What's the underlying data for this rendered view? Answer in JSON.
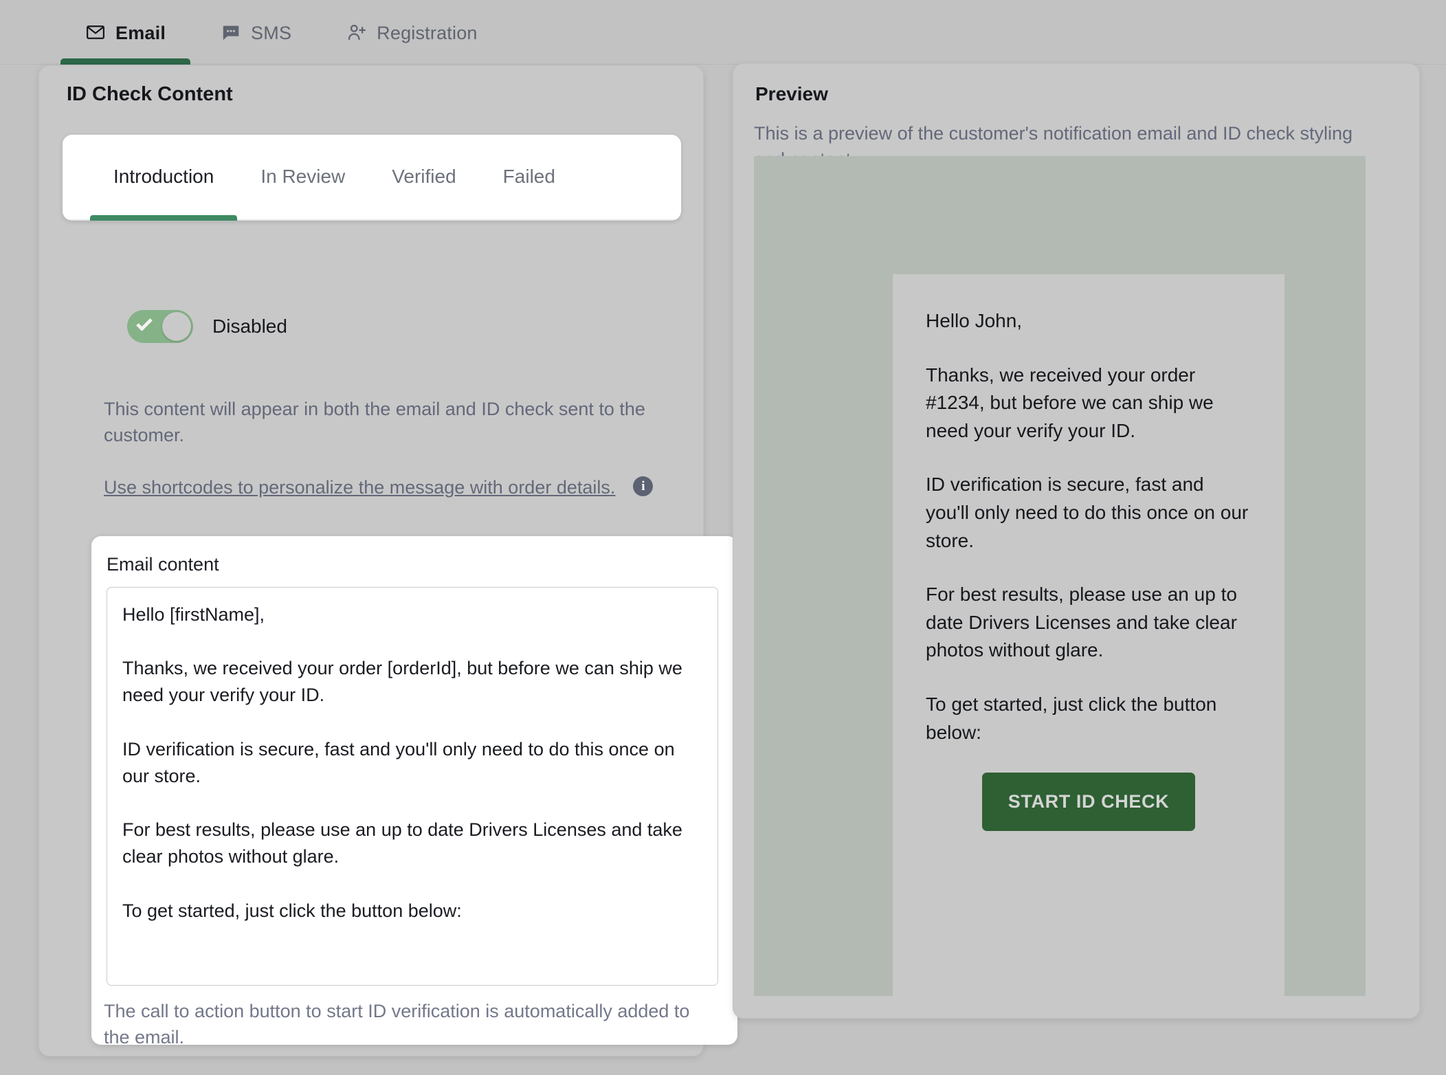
{
  "top_tabs": [
    {
      "label": "Email",
      "icon": "envelope-icon",
      "active": true
    },
    {
      "label": "SMS",
      "icon": "chat-bubble-icon",
      "active": false
    },
    {
      "label": "Registration",
      "icon": "person-add-icon",
      "active": false
    }
  ],
  "left_panel": {
    "title": "ID Check Content",
    "sub_tabs": [
      {
        "label": "Introduction",
        "active": true
      },
      {
        "label": "In Review",
        "active": false
      },
      {
        "label": "Verified",
        "active": false
      },
      {
        "label": "Failed",
        "active": false
      }
    ],
    "toggle": {
      "label": "Disabled",
      "state": "on",
      "track_color": "#86b288",
      "knob_color": "#c9c9c9"
    },
    "description": "This content will appear in both the email and ID check sent to the customer.",
    "shortcode_link": "Use shortcodes to personalize the message with order details.",
    "info_icon_glyph": "i",
    "email_content_label": "Email content",
    "email_content_value": "Hello [firstName],\n\nThanks, we received your order [orderId], but before we can ship we need your verify your ID.\n\nID verification is secure, fast and you'll only need to do this once on our store.\n\nFor best results, please use an up to date Drivers Licenses and take clear photos without glare.\n\nTo get started, just click the button below:",
    "email_helper_text": "The call to action button to start ID verification is automatically added to the email."
  },
  "right_panel": {
    "title": "Preview",
    "subtitle": "This is a preview of the customer's notification email and ID check styling and content.",
    "email_preview": {
      "paragraphs": [
        "Hello John,",
        "Thanks, we received your order #1234, but before we can ship we need your verify your ID.",
        "ID verification is secure, fast and you'll only need to do this once on our store.",
        "For best results, please use an up to date Drivers Licenses and take clear photos without glare.",
        "To get started, just click the button below:"
      ],
      "cta_label": "START ID CHECK"
    }
  },
  "colors": {
    "accent_green": "#2d6849",
    "subtab_green": "#3e8a63",
    "cta_green": "#2e6033",
    "page_bg": "#c2c2c2",
    "card_bg": "#c8c8c8",
    "preview_frame_bg": "#b3bab4"
  }
}
